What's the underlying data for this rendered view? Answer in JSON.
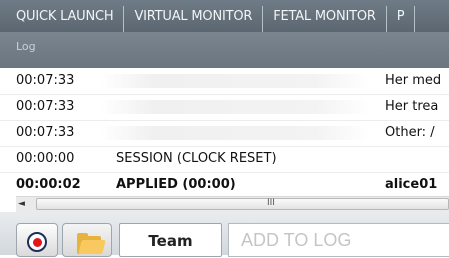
{
  "nav": {
    "tabs": [
      "QUICK LAUNCH",
      "VIRTUAL MONITOR",
      "FETAL MONITOR",
      "P"
    ]
  },
  "log": {
    "header": "Log",
    "rows": [
      {
        "time": "00:07:33",
        "event": "",
        "detail": "Her med",
        "bold": false
      },
      {
        "time": "00:07:33",
        "event": "",
        "detail": "Her trea",
        "bold": false
      },
      {
        "time": "00:07:33",
        "event": "",
        "detail": "Other: /",
        "bold": false
      },
      {
        "time": "00:00:00",
        "event": "SESSION (CLOCK RESET)",
        "detail": "",
        "bold": false
      },
      {
        "time": "00:00:02",
        "event": "APPLIED (00:00)",
        "detail": "alice01",
        "bold": true
      }
    ]
  },
  "scrollbar": {
    "left_arrow": "◄",
    "grip": "III"
  },
  "toolbar": {
    "record_icon": "record-icon",
    "folder_icon": "folder-icon",
    "team_label": "Team",
    "add_log_placeholder": "ADD TO LOG"
  },
  "colors": {
    "nav_bg": "#65717c",
    "record_red": "#e2141c",
    "folder_yellow": "#f7c960"
  }
}
